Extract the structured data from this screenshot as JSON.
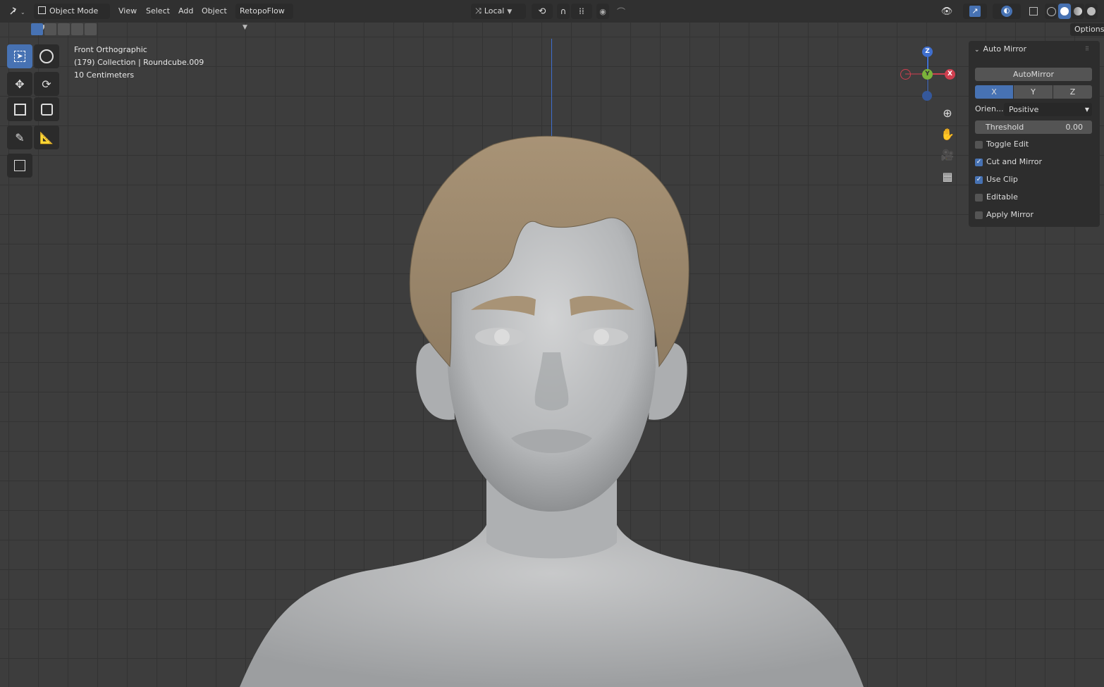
{
  "header": {
    "mode": "Object Mode",
    "menus": [
      "View",
      "Select",
      "Add",
      "Object"
    ],
    "addon_menu": "RetopoFlow",
    "transform_orientation": "Local"
  },
  "overlay": {
    "view_name": "Front Orthographic",
    "collection": "(179) Collection | Roundcube.009",
    "scale": "10 Centimeters"
  },
  "gizmo": {
    "x": "X",
    "y": "Y",
    "z": "Z"
  },
  "panel": {
    "options_label": "Options",
    "title": "Auto Mirror",
    "run_button": "AutoMirror",
    "axis": [
      "X",
      "Y",
      "Z"
    ],
    "active_axis": "X",
    "orientation_label": "Orien...",
    "orientation_value": "Positive",
    "threshold_label": "Threshold",
    "threshold_value": "0.00",
    "toggles": [
      {
        "label": "Toggle Edit",
        "checked": false
      },
      {
        "label": "Cut and Mirror",
        "checked": true
      },
      {
        "label": "Use Clip",
        "checked": true
      },
      {
        "label": "Editable",
        "checked": false
      },
      {
        "label": "Apply Mirror",
        "checked": false
      }
    ]
  },
  "colors": {
    "accent": "#4772b3",
    "hair": "#a89376",
    "skin": "#b9bbbd"
  }
}
